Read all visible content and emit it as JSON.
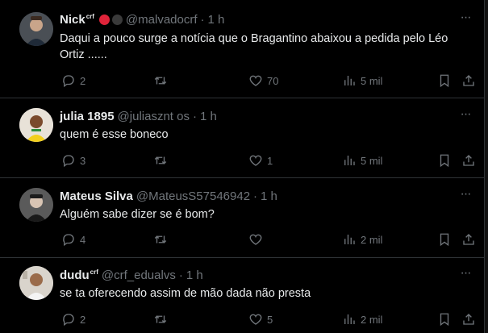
{
  "tweets": [
    {
      "name": "Nick",
      "name_sup": "crf",
      "handle": "@malvadocrf",
      "time": "1 h",
      "text": "Daqui a pouco surge a notícia que o Bragantino abaixou a pedida pelo Léo Ortiz ......",
      "replies": "2",
      "retweets": "",
      "likes": "70",
      "views": "5 mil"
    },
    {
      "name": "julia 1895",
      "name_sup": "",
      "handle": "@juliasznt os",
      "time": "1 h",
      "text": "quem é esse boneco",
      "replies": "3",
      "retweets": "",
      "likes": "1",
      "views": "5 mil"
    },
    {
      "name": "Mateus Silva",
      "name_sup": "",
      "handle": "@MateusS57546942",
      "time": "1 h",
      "text": "Alguém sabe dizer se é bom?",
      "replies": "4",
      "retweets": "",
      "likes": "",
      "views": "2 mil"
    },
    {
      "name": "dudu",
      "name_sup": "crf",
      "handle": "@crf_edualvs",
      "time": "1 h",
      "text": "se ta oferecendo assim de mão dada não presta",
      "replies": "2",
      "retweets": "",
      "likes": "5",
      "views": "2 mil"
    }
  ],
  "separator": "·",
  "more_glyph": "···",
  "colors": {
    "background": "#000000",
    "text": "#e7e9ea",
    "muted": "#71767b",
    "border": "#2f3336",
    "badge_red": "#e0243a",
    "badge_dark": "#3a3a3a"
  },
  "icons": [
    "reply-icon",
    "retweet-icon",
    "like-icon",
    "views-icon",
    "bookmark-icon",
    "share-icon",
    "more-icon"
  ]
}
